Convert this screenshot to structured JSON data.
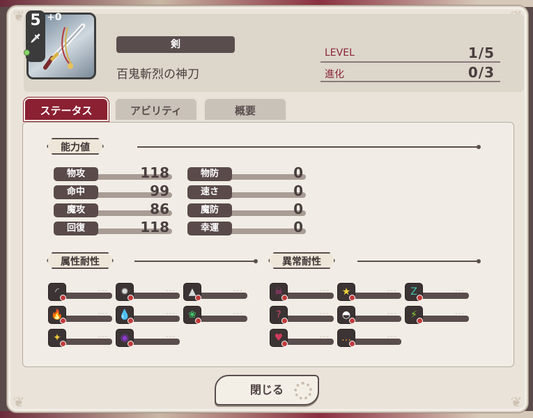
{
  "header": {
    "rank": "5",
    "plus_label": "+0",
    "weapon_type": "剣",
    "weapon_name": "百鬼斬烈の神刀",
    "level_label": "LEVEL",
    "level_value": "1/5",
    "evolution_label": "進化",
    "evolution_value": "0/3"
  },
  "tabs": [
    {
      "label": "ステータス",
      "active": true
    },
    {
      "label": "アビリティ",
      "active": false
    },
    {
      "label": "概要",
      "active": false
    }
  ],
  "sections": {
    "stats_title": "能力値",
    "element_title": "属性耐性",
    "status_title": "異常耐性"
  },
  "stats": {
    "left": [
      {
        "label": "物攻",
        "value": "118"
      },
      {
        "label": "命中",
        "value": "99"
      },
      {
        "label": "魔攻",
        "value": "86"
      },
      {
        "label": "回復",
        "value": "118"
      }
    ],
    "right": [
      {
        "label": "物防",
        "value": "0"
      },
      {
        "label": "速さ",
        "value": "0"
      },
      {
        "label": "魔防",
        "value": "0"
      },
      {
        "label": "幸運",
        "value": "0"
      }
    ]
  },
  "element_resist": [
    {
      "icon": "slash-icon",
      "glyph": "◜",
      "color": "#d9d9d9",
      "value": "---"
    },
    {
      "icon": "impact-icon",
      "glyph": "✹",
      "color": "#d9d9d9",
      "value": "---"
    },
    {
      "icon": "pierce-icon",
      "glyph": "▲",
      "color": "#d9d9d9",
      "value": "---"
    },
    {
      "icon": "fire-icon",
      "glyph": "🔥",
      "color": "#f07a2a",
      "value": "---"
    },
    {
      "icon": "water-icon",
      "glyph": "💧",
      "color": "#3aa0e0",
      "value": "---"
    },
    {
      "icon": "wind-icon",
      "glyph": "❀",
      "color": "#3ec46a",
      "value": "---"
    },
    {
      "icon": "light-icon",
      "glyph": "✦",
      "color": "#f0c73a",
      "value": "---"
    },
    {
      "icon": "dark-icon",
      "glyph": "◉",
      "color": "#8a3ad0",
      "value": "---"
    }
  ],
  "status_resist": [
    {
      "icon": "poison-icon",
      "glyph": "☠",
      "color": "#c23a8a",
      "value": "---"
    },
    {
      "icon": "stun-icon",
      "glyph": "★",
      "color": "#f0d43a",
      "value": "---"
    },
    {
      "icon": "sleep-icon",
      "glyph": "Z",
      "color": "#3ec4b0",
      "value": "---"
    },
    {
      "icon": "confuse-icon",
      "glyph": "?",
      "color": "#d04a6a",
      "value": "---"
    },
    {
      "icon": "blind-icon",
      "glyph": "◓",
      "color": "#ffffff",
      "value": "---"
    },
    {
      "icon": "paralyze-icon",
      "glyph": "⚡",
      "color": "#8ad43a",
      "value": "---"
    },
    {
      "icon": "charm-icon",
      "glyph": "♥",
      "color": "#d03a5a",
      "value": "---"
    },
    {
      "icon": "silence-icon",
      "glyph": "…",
      "color": "#f0a03a",
      "value": "---"
    }
  ],
  "close_label": "閉じる"
}
